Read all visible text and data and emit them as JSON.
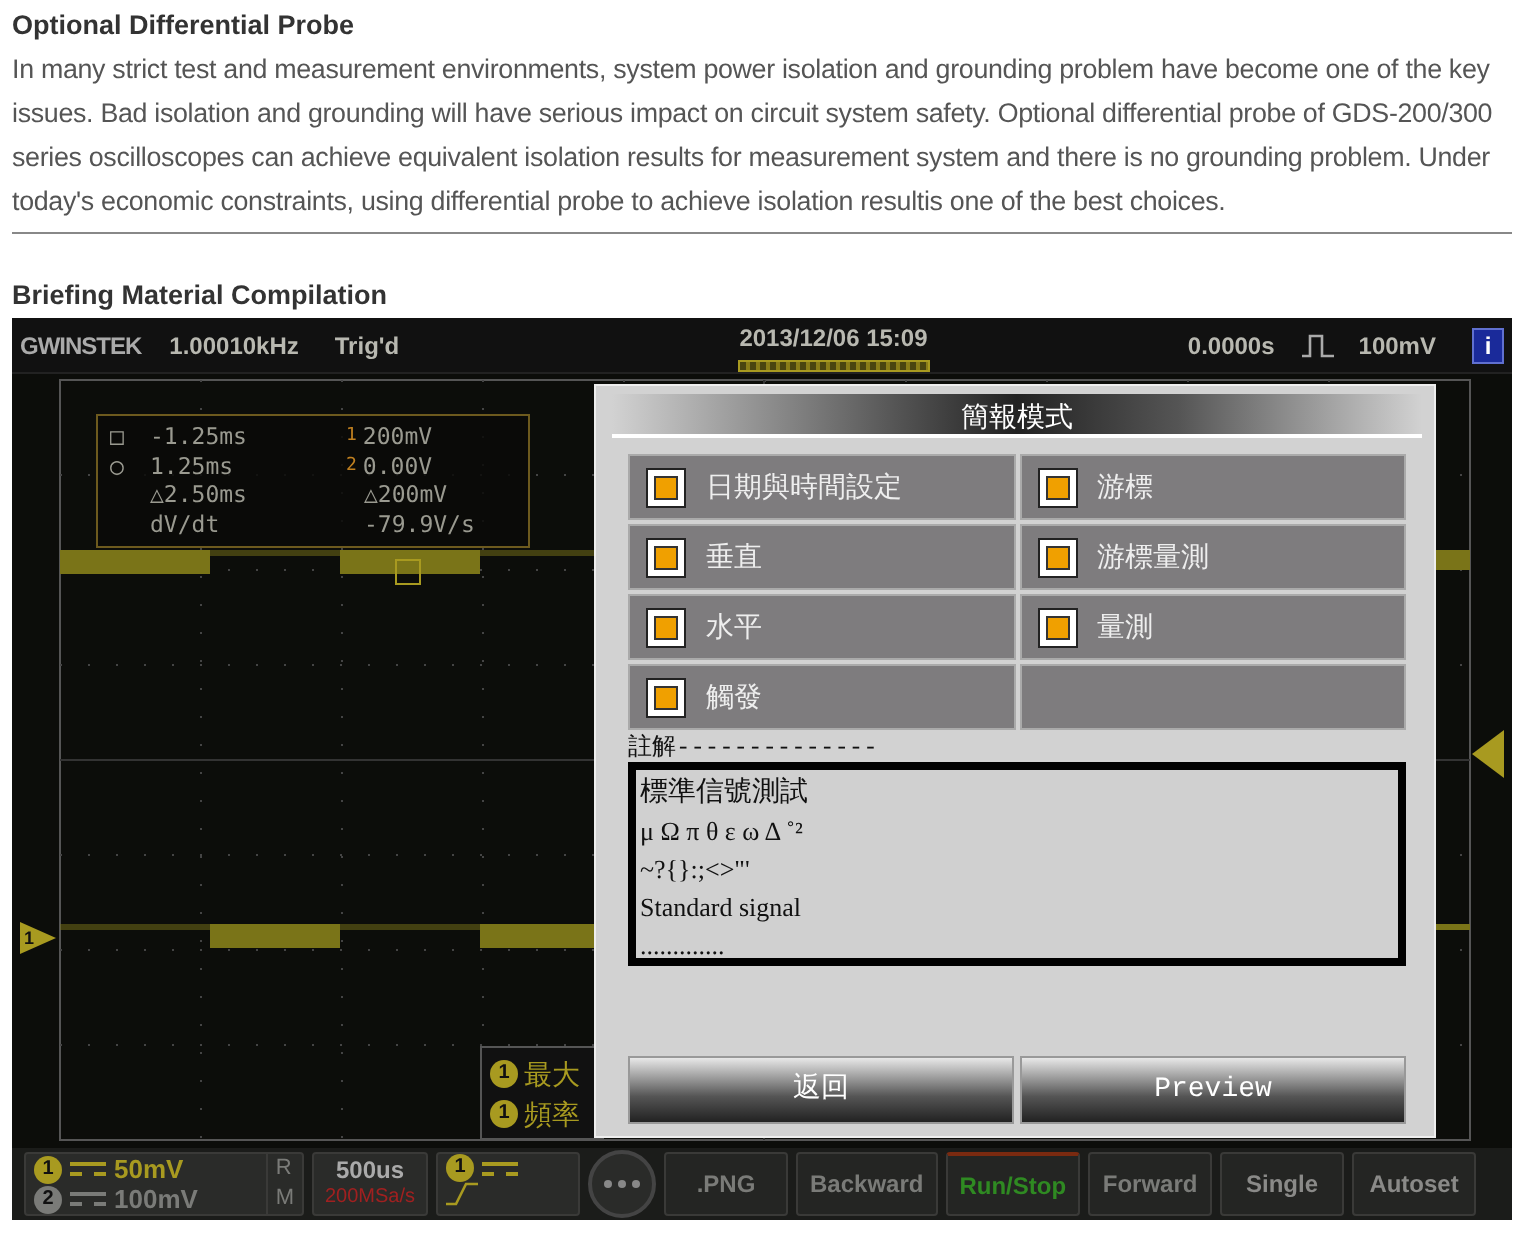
{
  "article": {
    "heading": "Optional Differential Probe",
    "paragraph": "In many strict test and measurement environments, system power isolation and grounding problem have become one of the key issues. Bad isolation and grounding will have serious impact on circuit system safety. Optional differential probe of GDS-200/300 series oscilloscopes can achieve equivalent isolation results for measurement system and there is no grounding problem. Under today's economic constraints, using differential probe to achieve isolation resultis one of the best choices."
  },
  "section_heading": "Briefing Material Compilation",
  "scope": {
    "top_bar": {
      "brand": "GWINSTEK",
      "frequency": "1.00010kHz",
      "trigger_status": "Trig'd",
      "datetime": "2013/12/06  15:09",
      "time_offset": "0.0000s",
      "trigger_level": "100mV",
      "info": "i"
    },
    "cursor_readout": [
      {
        "marker": "□",
        "time": "-1.25ms",
        "channel": "1",
        "value": "200mV"
      },
      {
        "marker": "○",
        "time": "1.25ms",
        "channel": "2",
        "value": "0.00V"
      },
      {
        "time": "△2.50ms",
        "value": "△200mV"
      },
      {
        "time": "dV/dt",
        "value": "-79.9V/s"
      }
    ],
    "measurements": [
      {
        "channel": "1",
        "label": "最大"
      },
      {
        "channel": "1",
        "label": "頻率"
      }
    ],
    "channel_marker": "1",
    "dialog": {
      "title": "簡報模式",
      "options": [
        {
          "label": "日期與時間設定",
          "checked": true
        },
        {
          "label": "游標",
          "checked": true
        },
        {
          "label": "垂直",
          "checked": true
        },
        {
          "label": "游標量測",
          "checked": true
        },
        {
          "label": "水平",
          "checked": true
        },
        {
          "label": "量測",
          "checked": true
        },
        {
          "label": "觸發",
          "checked": true
        }
      ],
      "note_label": "註解--------------",
      "note_lines": [
        "標準信號測試",
        "μ Ω π θ ε ω Δ ˚²",
        "~?{}:;<>\"'",
        "Standard signal",
        "............."
      ],
      "buttons": [
        "返回",
        "Preview"
      ]
    },
    "bottom_bar": {
      "channels": [
        {
          "channel": "1",
          "scale": "50mV",
          "enabled": true
        },
        {
          "channel": "2",
          "scale": "100mV",
          "enabled": false
        }
      ],
      "ref": "R",
      "math": "M",
      "timebase": "500us",
      "sample_rate": "200MSa/s",
      "trigger_channel": "1",
      "buttons": [
        {
          "label": ".PNG",
          "kind": "dim"
        },
        {
          "label": "Backward",
          "kind": "dim"
        },
        {
          "label": "Run/Stop",
          "kind": "running"
        },
        {
          "label": "Forward",
          "kind": "dim"
        },
        {
          "label": "Single",
          "kind": "normal"
        },
        {
          "label": "Autoset",
          "kind": "normal"
        }
      ]
    }
  }
}
